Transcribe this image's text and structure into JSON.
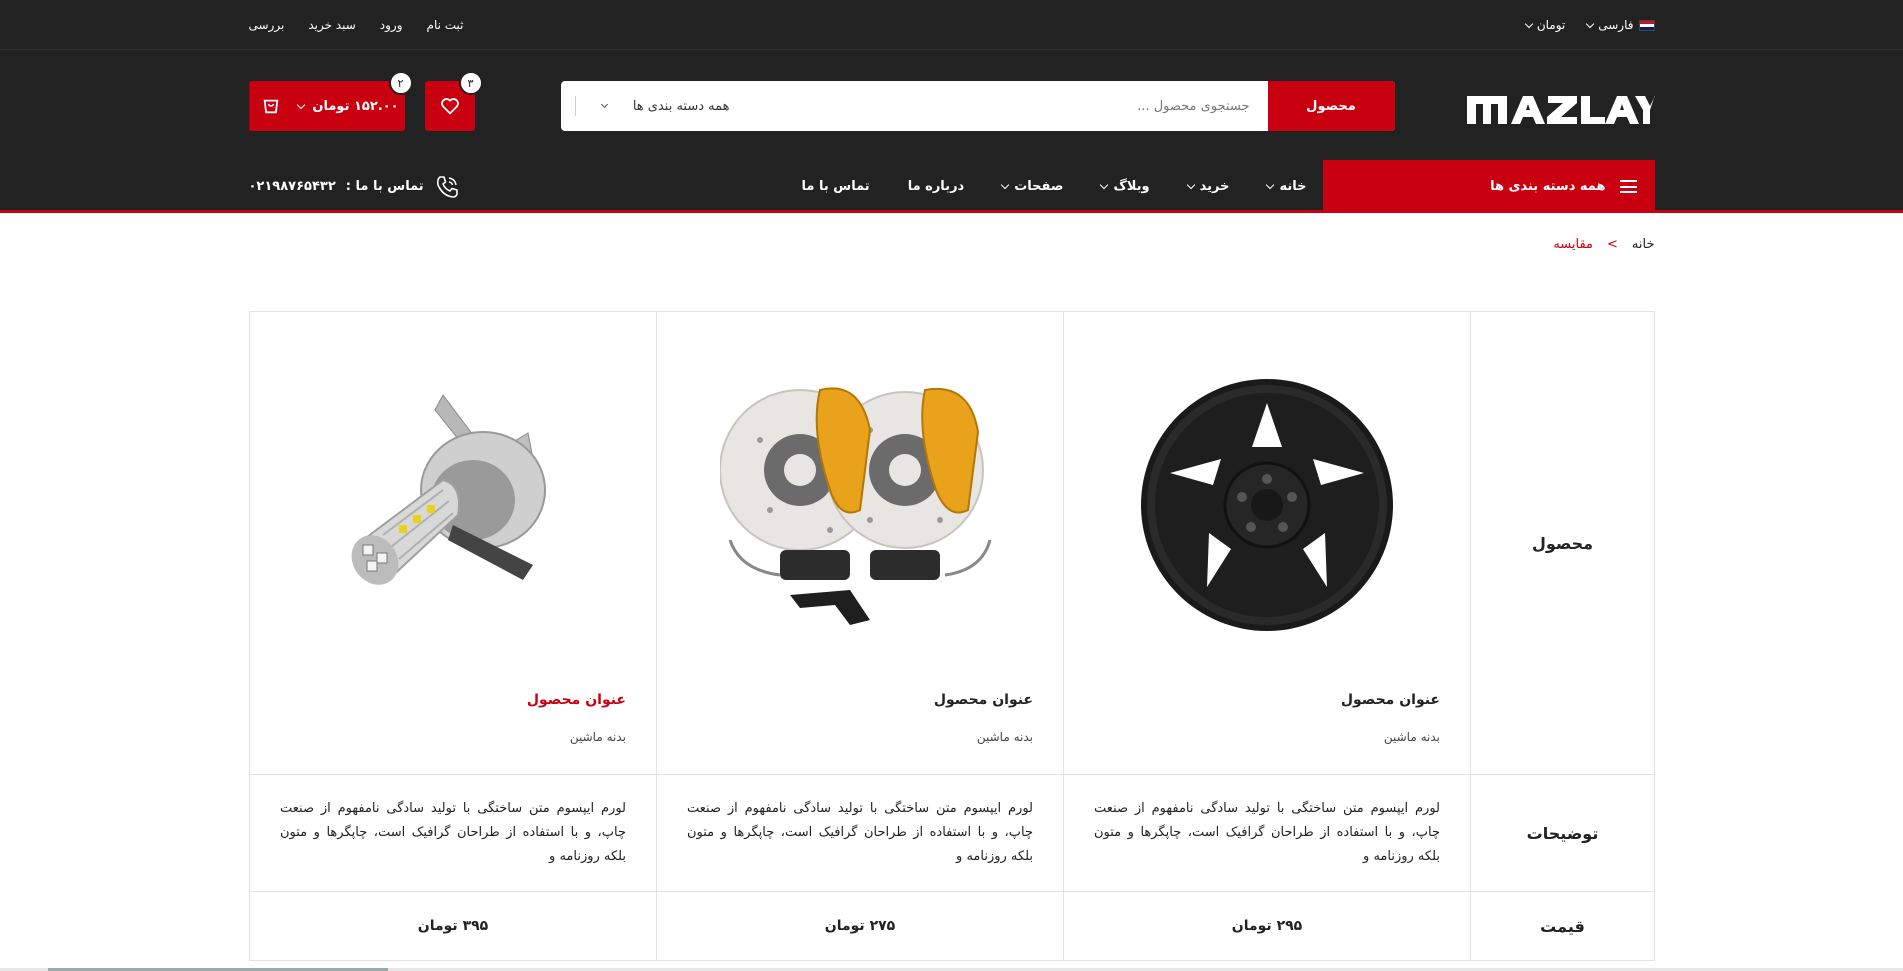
{
  "topbar": {
    "language": "فارسی",
    "currency": "تومان",
    "links": [
      "ثبت نام",
      "ورود",
      "سبد خرید",
      "بررسی"
    ]
  },
  "header": {
    "logo_text": "MAZLAY",
    "search": {
      "category_label": "همه دسته بندی ها",
      "placeholder": "جستجوی محصول ...",
      "button_label": "محصول"
    },
    "wishlist_count": "۳",
    "cart_count": "۲",
    "cart_amount": "۱۵۲.۰۰ تومان"
  },
  "nav": {
    "all_categories": "همه دسته بندی ها",
    "items": [
      {
        "label": "خانه",
        "dropdown": true
      },
      {
        "label": "خرید",
        "dropdown": true
      },
      {
        "label": "وبلاگ",
        "dropdown": true
      },
      {
        "label": "صفحات",
        "dropdown": true
      },
      {
        "label": "درباره ما",
        "dropdown": false
      },
      {
        "label": "تماس با ما",
        "dropdown": false
      }
    ],
    "contact_label": "تماس با ما :",
    "contact_phone": "۰۲۱۹۸۷۶۵۴۳۲"
  },
  "breadcrumb": {
    "home": "خانه",
    "separator": ">",
    "current": "مقایسه"
  },
  "compare": {
    "row_labels": {
      "product": "محصول",
      "description": "توضیحات",
      "price": "قیمت"
    },
    "products": [
      {
        "image": "wheel-hubcap-image",
        "title": "عنوان محصول",
        "category": "بدنه ماشین",
        "description": "لورم ایپسوم متن ساختگی با تولید سادگی نامفهوم از صنعت چاپ، و با استفاده از طراحان گرافیک است، چاپگرها و متون بلکه روزنامه و",
        "price": "۲۹۵ تومان"
      },
      {
        "image": "brake-calipers-image",
        "title": "عنوان محصول",
        "category": "بدنه ماشین",
        "description": "لورم ایپسوم متن ساختگی با تولید سادگی نامفهوم از صنعت چاپ، و با استفاده از طراحان گرافیک است، چاپگرها و متون بلکه روزنامه و",
        "price": "۲۷۵ تومان"
      },
      {
        "image": "headlight-bulb-image",
        "title": "عنوان محصول",
        "category": "بدنه ماشین",
        "description": "لورم ایپسوم متن ساختگی با تولید سادگی نامفهوم از صنعت چاپ، و با استفاده از طراحان گرافیک است، چاپگرها و متون بلکه روزنامه و",
        "price": "۳۹۵ تومان"
      }
    ]
  },
  "colors": {
    "brand_red": "#c8000f",
    "dark_bg": "#222222"
  }
}
